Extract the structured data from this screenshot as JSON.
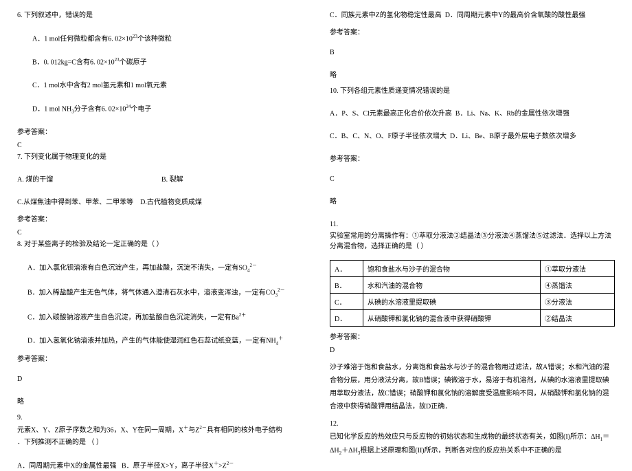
{
  "q6": {
    "stem": "6. 下列叙述中，错误的是",
    "a": "A．1 mol任何微粒都含有6. 02×10",
    "a_exp": "23",
    "a_tail": "个该种微粒",
    "b": "B．0. 012kg=C含有6. 02×10",
    "b_exp": "23",
    "b_tail": "个碳原子",
    "c": "C．1 mol水中含有2 mol氢元素和1 mol氧元素",
    "d": "D．1 mol NH",
    "d_sub": "3",
    "d_mid": "分子含有6. 02×10",
    "d_exp": "24",
    "d_tail": "个电子",
    "ans_label": "参考答案：",
    "ans": "C"
  },
  "q7": {
    "stem": "7. 下列变化属于物理变化的是",
    "a": "A. 煤的干馏",
    "b": "B. 裂解",
    "c": "C.从煤焦油中得到苯、甲苯、二甲苯等",
    "d": "D.古代植物变质成煤",
    "ans_label": "参考答案：",
    "ans": "C"
  },
  "q8": {
    "stem": "8. 对于某些离子的检验及结论一定正确的是（   ）",
    "a": "A．加入氯化钡溶液有白色沉淀产生，再加盐酸，沉淀不消失，一定有SO",
    "a_sub": "4",
    "a_sup": "2－",
    "b": "B．加入稀盐酸产生无色气体，将气体通入澄清石灰水中，溶液变浑浊，一定有CO",
    "b_sub": "3",
    "b_sup": "2－",
    "c": "C．加入碳酸钠溶液产生白色沉淀，再加盐酸白色沉淀消失，一定有Ba",
    "c_sup": "2＋",
    "d": "D．加入氢氧化钠溶液并加热，产生的气体能使湿润红色石蕊试纸变蓝，一定有NH",
    "d_sub": "4",
    "d_sup": "＋",
    "ans_label": "参考答案：",
    "ans": "D",
    "略": "略"
  },
  "q9": {
    "num": "9.",
    "stem1": "元素X、Y、Z原子序数之和为36，X、Y在同一周期，X",
    "stem1_sup": "＋",
    "stem1_mid": "与Z",
    "stem1_sup2": "2－",
    "stem1_tail": "具有相同的核外电子结构",
    "stem2": "．下列推测不正确的是              （     ）",
    "a": "A．同周期元素中X的金属性最强",
    "b": "B．原子半径X>Y，离子半径X",
    "b_sup": "＋",
    "b_mid": ">Z",
    "b_sup2": "2－",
    "c": "C．同族元素中Z的氢化物稳定性最高",
    "d": "D．同周期元素中Y的最高价含氧酸的酸性最强",
    "ans_label": "参考答案：",
    "ans": "B",
    "略": "略"
  },
  "q10": {
    "stem": "10. 下列各组元素性质递变情况错误的是",
    "a": "A．P、S、Cl元素最高正化合价依次升高",
    "b": "B．Li、Na、K、Rb的金属性依次增强",
    "c": "C．B、C、N、O、F原子半径依次增大",
    "d": "D．Li、Be、B原子最外层电子数依次增多",
    "ans_label": "参考答案：",
    "ans": "C",
    "略": "略"
  },
  "q11": {
    "num": "11.",
    "stem": "实验室常用的分离操作有：①萃取分液法②结晶法③分液法④蒸馏法⑤过滤法．选择以上方法分离混合物，选择正确的是（   ）",
    "rowA": {
      "k": "A．",
      "mid": "饱和食盐水与沙子的混合物",
      "r": "①萃取分液法"
    },
    "rowB": {
      "k": "B．",
      "mid": "水和汽油的混合物",
      "r": "④蒸馏法"
    },
    "rowC": {
      "k": "C．",
      "mid": "从碘的水溶液里提取碘",
      "r": "③分液法"
    },
    "rowD": {
      "k": "D．",
      "mid": "从硝酸钾和氯化钠的混合液中获得硝酸钾",
      "r": "②结晶法"
    },
    "ans_label": "参考答案：",
    "ans": "D",
    "explain": "沙子难溶于饱和食盐水，分离饱和食盐水与沙子的混合物用过滤法，故A错误；水和汽油的混合物分层，用分液法分离，故B错误；碘微溶于水，易溶于有机溶剂，从碘的水溶液里提取碘用萃取分液法，故C错误；硝酸钾和氯化钠的溶解度受温度影响不同，从硝酸钾和氯化钠的混合液中获得硝酸钾用结晶法，故D正确．"
  },
  "q12": {
    "num": "12.",
    "stem1": "已知化学反应的热效应只与反应物的初始状态和生成物的最终状态有关，如图(I)所示：ΔH",
    "sub1": "1",
    "stem2": "＝ΔH",
    "sub2": "2",
    "stem3": "＋ΔH",
    "sub3": "3",
    "stem4": "根据上述原理和图(II)所示，判断各对应的反应热关系中不正确的是"
  }
}
